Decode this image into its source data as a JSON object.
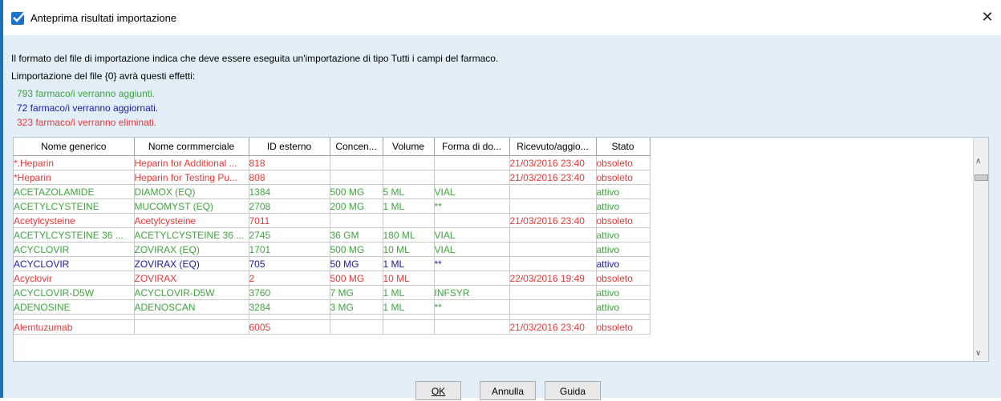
{
  "window": {
    "title": "Anteprima risultati importazione"
  },
  "info": {
    "format_line": "Il formato del file di importazione indica che deve essere eseguita un'importazione di tipo Tutti i campi del farmaco.",
    "effects_line": "Limportazione del file {0} avrà questi effetti:",
    "added": "793 farmaco/i verranno aggiunti.",
    "updated": "72 farmaco/i verranno aggiornati.",
    "deleted": "323 farmaco/i verranno eliminati."
  },
  "colors": {
    "added": "#3fa43f",
    "updated": "#1a1aa6",
    "deleted": "#e23a3a",
    "accent": "#1a74c9"
  },
  "table": {
    "columns": [
      "Nome generico",
      "Nome cormmerciale",
      "ID esterno",
      "Concen...",
      "Volume",
      "Forma di do...",
      "Ricevuto/aggio...",
      "Stato"
    ],
    "rows": [
      {
        "type": "deleted",
        "cells": [
          "*.Heparin",
          "Heparin for Additional ...",
          "818",
          "",
          "",
          "",
          "21/03/2016 23:40",
          "obsoleto"
        ]
      },
      {
        "type": "deleted",
        "cells": [
          "*Heparin",
          "Heparin for Testing Pu...",
          "808",
          "",
          "",
          "",
          "21/03/2016 23:40",
          "obsoleto"
        ]
      },
      {
        "type": "added",
        "cells": [
          "ACETAZOLAMIDE",
          "DIAMOX (EQ)",
          "1384",
          "500 MG",
          "5 ML",
          "VIAL",
          "",
          "attivo"
        ]
      },
      {
        "type": "added",
        "cells": [
          "ACETYLCYSTEINE",
          "MUCOMYST (EQ)",
          "2708",
          "200 MG",
          "1 ML",
          "**",
          "",
          "attivo"
        ]
      },
      {
        "type": "deleted",
        "cells": [
          "Acetylcysteine",
          "Acetylcysteine",
          "7011",
          "",
          "",
          "",
          "21/03/2016 23:40",
          "obsoleto"
        ]
      },
      {
        "type": "added",
        "cells": [
          "ACETYLCYSTEINE 36 ...",
          "ACETYLCYSTEINE 36 ...",
          "2745",
          "36 GM",
          "180 ML",
          "VIAL",
          "",
          "attivo"
        ]
      },
      {
        "type": "added",
        "cells": [
          "ACYCLOVIR",
          "ZOVIRAX  (EQ)",
          "1701",
          "500 MG",
          "10 ML",
          "VIAL",
          "",
          "attivo"
        ]
      },
      {
        "type": "updated",
        "cells": [
          "ACYCLOVIR",
          "ZOVIRAX  (EQ)",
          "705",
          "50 MG",
          "1 ML",
          "**",
          "",
          "attivo"
        ]
      },
      {
        "type": "deleted",
        "cells": [
          "Acyclovir",
          "ZOVIRAX",
          "2",
          "500 MG",
          "10 ML",
          "",
          "22/03/2016 19:49",
          "obsoleto"
        ]
      },
      {
        "type": "added",
        "cells": [
          "ACYCLOVIR-D5W",
          "ACYCLOVIR-D5W",
          "3760",
          "7 MG",
          "1 ML",
          "INFSYR",
          "",
          "attivo"
        ]
      },
      {
        "type": "added",
        "cells": [
          "ADENOSINE",
          "ADENOSCAN",
          "3284",
          "3 MG",
          "1 ML",
          "**",
          "",
          "attivo"
        ]
      },
      {
        "type": "spacer",
        "cells": [
          "",
          "",
          "",
          "",
          "",
          "",
          "",
          ""
        ]
      },
      {
        "type": "deleted",
        "cells": [
          "Alemtuzumab",
          "",
          "6005",
          "",
          "",
          "",
          "21/03/2016 23:40",
          "obsoleto"
        ]
      }
    ]
  },
  "buttons": {
    "ok": "OK",
    "cancel": "Annulla",
    "help": "Guida"
  }
}
